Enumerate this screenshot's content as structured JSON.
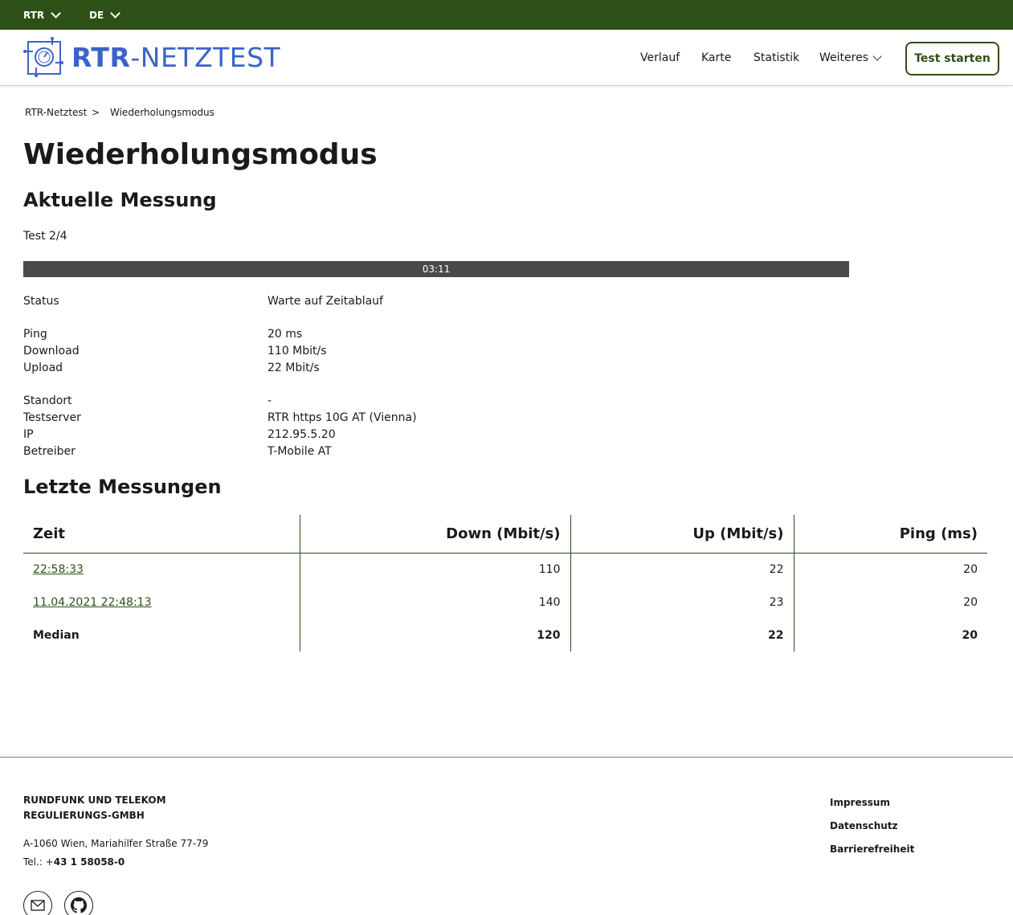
{
  "topbar": {
    "org_select": "RTR",
    "lang_select": "DE"
  },
  "header": {
    "logo": {
      "text_bold": "RTR",
      "text_rest": "-NETZTEST"
    },
    "nav": [
      "Verlauf",
      "Karte",
      "Statistik",
      "Weiteres"
    ],
    "start_button": "Test starten"
  },
  "breadcrumb": {
    "home": "RTR-Netztest",
    "separator": ">",
    "current": "Wiederholungsmodus"
  },
  "page_title": "Wiederholungsmodus",
  "current": {
    "heading": "Aktuelle Messung",
    "test_count": "Test 2/4",
    "progress": {
      "label": "03:11",
      "fraction": 0
    },
    "rows": [
      {
        "label": "Status",
        "value": "Warte auf Zeitablauf"
      },
      {
        "label": "Ping",
        "value": "20 ms"
      },
      {
        "label": "Download",
        "value": "110 Mbit/s"
      },
      {
        "label": "Upload",
        "value": "22 Mbit/s"
      },
      {
        "label": "Standort",
        "value": "-"
      },
      {
        "label": "Testserver",
        "value": "RTR https 10G AT (Vienna)"
      },
      {
        "label": "IP",
        "value": "212.95.5.20"
      },
      {
        "label": "Betreiber",
        "value": "T-Mobile AT"
      }
    ]
  },
  "last": {
    "heading": "Letzte Messungen",
    "columns": [
      "Zeit",
      "Down (Mbit/s)",
      "Up (Mbit/s)",
      "Ping (ms)"
    ],
    "rows": [
      {
        "time": "22:58:33",
        "down": "110",
        "up": "22",
        "ping": "20"
      },
      {
        "time": "11.04.2021 22:48:13",
        "down": "140",
        "up": "23",
        "ping": "20"
      }
    ],
    "median": {
      "label": "Median",
      "down": "120",
      "up": "22",
      "ping": "20"
    }
  },
  "footer": {
    "org_line1": "RUNDFUNK UND TELEKOM",
    "org_line2": "REGULIERUNGS-GMBH",
    "address": "A-1060 Wien, Mariahilfer Straße 77-79",
    "tel_prefix": "Tel.: +",
    "tel_number": "43 1 58058-0",
    "links": [
      "Impressum",
      "Datenschutz",
      "Barrierefreiheit"
    ],
    "icons": [
      "mail-icon",
      "github-icon"
    ]
  },
  "colors": {
    "brand_green": "#2d5016",
    "logo_blue": "#3b64c8",
    "progress_bar": "#4a4a4a"
  }
}
